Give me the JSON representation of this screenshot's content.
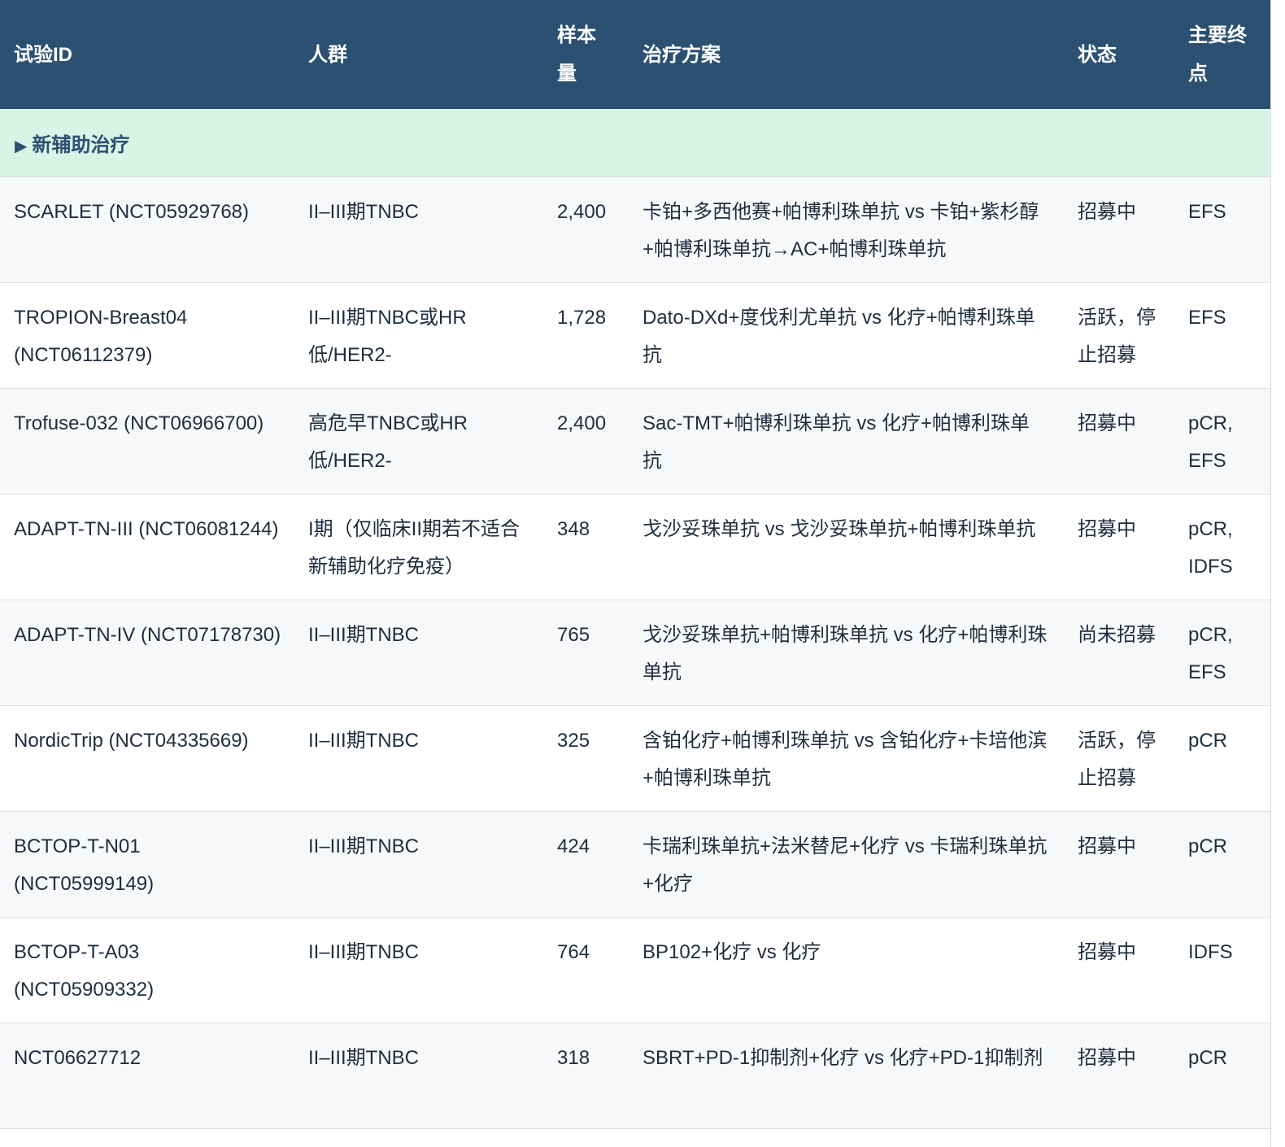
{
  "table": {
    "headers": {
      "trial_id": "试验ID",
      "population": "人群",
      "sample_size": "样本量",
      "regimen": "治疗方案",
      "status": "状态",
      "primary_endpoint": "主要终点"
    },
    "section": {
      "arrow": "▶",
      "label": "新辅助治疗"
    },
    "rows": [
      {
        "trial_id": "SCARLET (NCT05929768)",
        "population": "II–III期TNBC",
        "sample_size": "2,400",
        "regimen": "卡铂+多西他赛+帕博利珠单抗 vs 卡铂+紫杉醇+帕博利珠单抗→AC+帕博利珠单抗",
        "status": "招募中",
        "primary_endpoint": "EFS"
      },
      {
        "trial_id": "TROPION-Breast04 (NCT06112379)",
        "population": "II–III期TNBC或HR低/HER2-",
        "sample_size": "1,728",
        "regimen": "Dato-DXd+度伐利尤单抗 vs 化疗+帕博利珠单抗",
        "status": "活跃，停止招募",
        "primary_endpoint": "EFS"
      },
      {
        "trial_id": "Trofuse-032 (NCT06966700)",
        "population": "高危早TNBC或HR低/HER2-",
        "sample_size": "2,400",
        "regimen": "Sac-TMT+帕博利珠单抗 vs 化疗+帕博利珠单抗",
        "status": "招募中",
        "primary_endpoint": "pCR, EFS"
      },
      {
        "trial_id": "ADAPT-TN-III (NCT06081244)",
        "population": "I期（仅临床II期若不适合新辅助化疗免疫）",
        "sample_size": "348",
        "regimen": "戈沙妥珠单抗 vs 戈沙妥珠单抗+帕博利珠单抗",
        "status": "招募中",
        "primary_endpoint": "pCR, IDFS"
      },
      {
        "trial_id": "ADAPT-TN-IV (NCT07178730)",
        "population": "II–III期TNBC",
        "sample_size": "765",
        "regimen": "戈沙妥珠单抗+帕博利珠单抗 vs 化疗+帕博利珠单抗",
        "status": "尚未招募",
        "primary_endpoint": "pCR, EFS"
      },
      {
        "trial_id": "NordicTrip (NCT04335669)",
        "population": "II–III期TNBC",
        "sample_size": "325",
        "regimen": "含铂化疗+帕博利珠单抗 vs 含铂化疗+卡培他滨+帕博利珠单抗",
        "status": "活跃，停止招募",
        "primary_endpoint": "pCR"
      },
      {
        "trial_id": "BCTOP-T-N01 (NCT05999149)",
        "population": "II–III期TNBC",
        "sample_size": "424",
        "regimen": "卡瑞利珠单抗+法米替尼+化疗 vs 卡瑞利珠单抗+化疗",
        "status": "招募中",
        "primary_endpoint": "pCR"
      },
      {
        "trial_id": "BCTOP-T-A03 (NCT05909332)",
        "population": "II–III期TNBC",
        "sample_size": "764",
        "regimen": "BP102+化疗 vs 化疗",
        "status": "招募中",
        "primary_endpoint": "IDFS"
      },
      {
        "trial_id": "NCT06627712",
        "population": "II–III期TNBC",
        "sample_size": "318",
        "regimen": "SBRT+PD-1抑制剂+化疗 vs 化疗+PD-1抑制剂",
        "status": "招募中",
        "primary_endpoint": "pCR"
      }
    ]
  }
}
